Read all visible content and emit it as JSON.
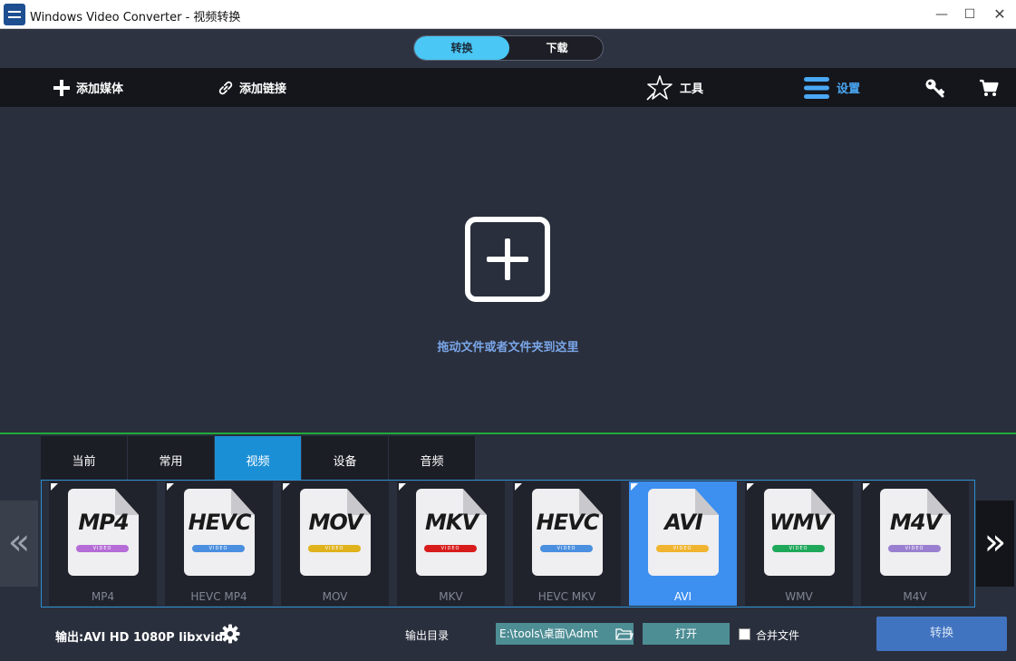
{
  "window": {
    "title": "Windows Video Converter - 视频转换",
    "minimize": "—",
    "maximize": "☐",
    "close": "✕"
  },
  "mode_switch": {
    "convert": "转换",
    "download": "下载",
    "active": "转换"
  },
  "toolbar": {
    "add_media": "添加媒体",
    "add_link": "添加链接",
    "tools": "工具",
    "settings": "设置"
  },
  "dropzone": {
    "hint": "拖动文件或者文件夹到这里"
  },
  "tabs": [
    {
      "label": "当前"
    },
    {
      "label": "常用"
    },
    {
      "label": "视频",
      "active": true
    },
    {
      "label": "设备"
    },
    {
      "label": "音频"
    }
  ],
  "navigation": {
    "prev": "«",
    "next": "»"
  },
  "formats": [
    {
      "fmt": "MP4",
      "label": "MP4",
      "pill": "#b56cd6",
      "badge": "VIDEO"
    },
    {
      "fmt": "HEVC",
      "label": "HEVC MP4",
      "pill": "#4a8fe0",
      "badge": "VIDEO"
    },
    {
      "fmt": "MOV",
      "label": "MOV",
      "pill": "#e0b21c",
      "badge": "VIDEO"
    },
    {
      "fmt": "MKV",
      "label": "MKV",
      "pill": "#d81c1c",
      "badge": "VIDEO"
    },
    {
      "fmt": "HEVC",
      "label": "HEVC MKV",
      "pill": "#4a8fe0",
      "badge": "VIDEO"
    },
    {
      "fmt": "AVI",
      "label": "AVI",
      "pill": "#f0b430",
      "badge": "VIDEO",
      "active": true
    },
    {
      "fmt": "WMV",
      "label": "WMV",
      "pill": "#1fa85a",
      "badge": "VIDEO"
    },
    {
      "fmt": "M4V",
      "label": "M4V",
      "pill": "#9a7fd0",
      "badge": "VIDEO"
    }
  ],
  "footer": {
    "output_label": "输出:AVI HD 1080P libxvid",
    "dir_label": "输出目录",
    "dir_value": "E:\\tools\\桌面\\Admt",
    "open_button": "打开",
    "merge_label": "合并文件",
    "merge_checked": false,
    "convert_button": "转换"
  },
  "colors": {
    "accent_blue": "#1b8fd6",
    "mode_active": "#4ac7f5",
    "settings_blue": "#4aa8f5",
    "divider_green": "#1faa3c",
    "convert_button": "#4174c0"
  }
}
